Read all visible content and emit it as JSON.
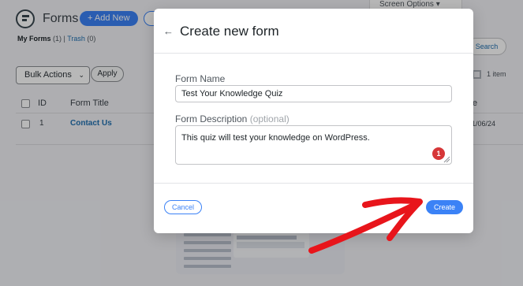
{
  "background": {
    "page_title": "Forms",
    "add_new_label": "+ Add New",
    "screen_options_label": "Screen Options",
    "subnav": {
      "my_forms": "My Forms",
      "my_forms_count": "(1)",
      "separator": "|",
      "trash": "Trash",
      "trash_count": "(0)"
    },
    "bulk_actions_label": "Bulk Actions",
    "apply_label": "Apply",
    "search_label": "Search",
    "item_count": "1 item",
    "columns": {
      "id": "ID",
      "form_title": "Form Title"
    },
    "rows": [
      {
        "id": "1",
        "title": "Contact Us",
        "date": "1/06/24"
      }
    ]
  },
  "modal": {
    "title": "Create new form",
    "form_name_label": "Form Name",
    "form_name_value": "Test Your Knowledge Quiz",
    "form_description_label": "Form Description",
    "form_description_optional": "(optional)",
    "form_description_value": "This quiz will test your knowledge on WordPress.",
    "notification_badge": "1",
    "cancel_label": "Cancel",
    "create_label": "Create"
  },
  "colors": {
    "accent": "#3b82f6",
    "badge": "#d63638",
    "arrow": "#e8151b"
  }
}
